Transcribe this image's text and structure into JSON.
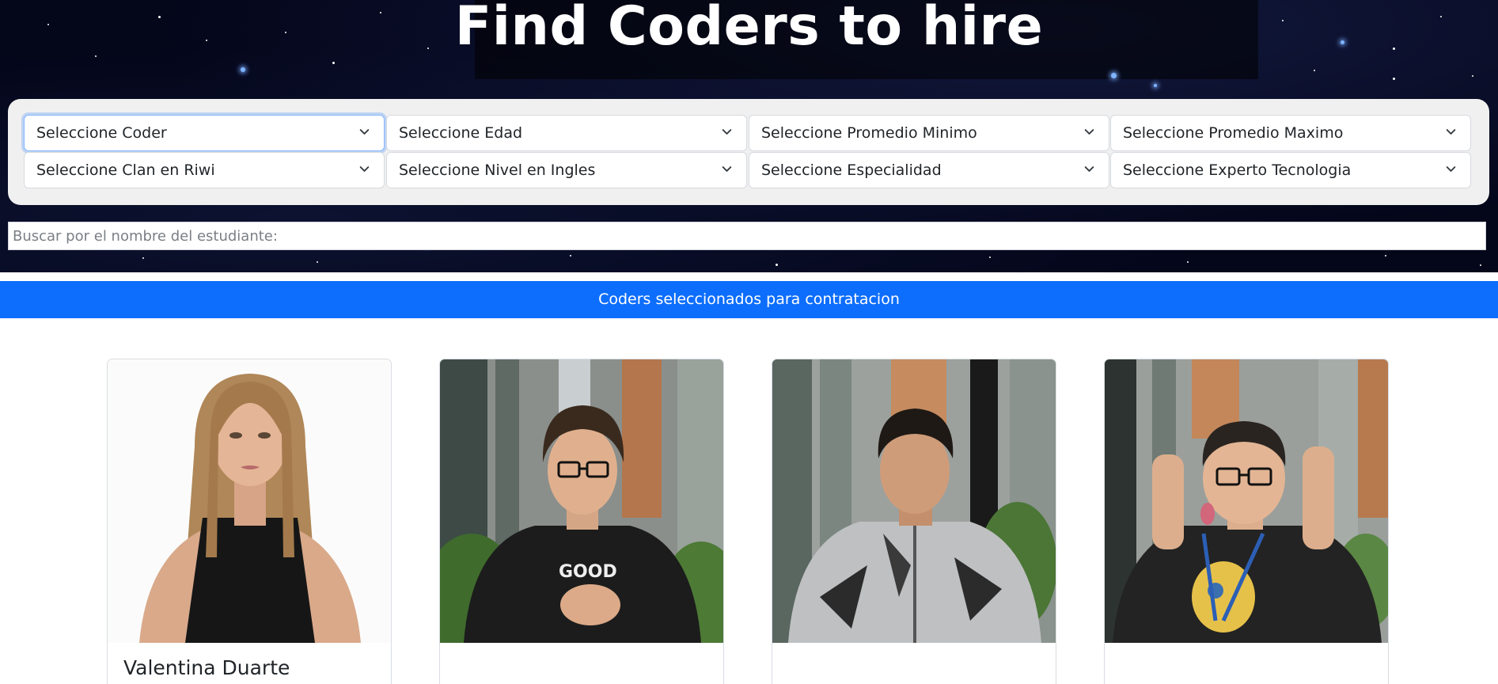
{
  "hero": {
    "title": "Find Coders to hire"
  },
  "filters": {
    "row1": [
      {
        "label": "Seleccione Coder"
      },
      {
        "label": "Seleccione Edad"
      },
      {
        "label": "Seleccione Promedio Minimo"
      },
      {
        "label": "Seleccione Promedio Maximo"
      }
    ],
    "row2": [
      {
        "label": "Seleccione Clan en Riwi"
      },
      {
        "label": "Seleccione Nivel en Ingles"
      },
      {
        "label": "Seleccione Especialidad"
      },
      {
        "label": "Seleccione Experto Tecnologia"
      }
    ]
  },
  "search": {
    "placeholder": "Buscar por el nombre del estudiante:",
    "value": ""
  },
  "selected_bar": {
    "label": "Coders seleccionados para contratacion"
  },
  "cards": [
    {
      "name": "Valentina Duarte",
      "photo": "portrait-photo"
    },
    {
      "name": "",
      "photo": "portrait-photo"
    },
    {
      "name": "",
      "photo": "portrait-photo"
    },
    {
      "name": "",
      "photo": "portrait-photo"
    }
  ],
  "colors": {
    "accent": "#0d6efd",
    "hero_bg": "#04061a",
    "panel_bg": "#f0f0f0"
  },
  "icons": {
    "select_arrow": "chevron-down-icon"
  }
}
